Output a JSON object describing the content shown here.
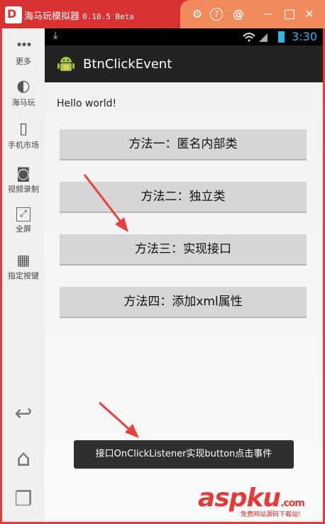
{
  "window": {
    "title": "海马玩模拟器",
    "version": "0.10.5 Beta",
    "logo_letter": "D"
  },
  "titlebar_icons": [
    "gear-icon",
    "help-icon",
    "at-icon",
    "minimize-icon",
    "maximize-icon",
    "close-icon"
  ],
  "titlebar_glyphs": [
    "⚙",
    "?",
    "@",
    "—",
    "□",
    "✕"
  ],
  "sidebar": {
    "items": [
      {
        "icon": "more-icon",
        "glyph": "•••",
        "label": "更多"
      },
      {
        "icon": "haima-icon",
        "glyph": "◐",
        "label": "海马玩"
      },
      {
        "icon": "phone-market-icon",
        "glyph": "▯",
        "label": "手机市场"
      },
      {
        "icon": "video-camera-icon",
        "glyph": "◙",
        "label": "视频录制"
      },
      {
        "icon": "fullscreen-icon",
        "glyph": "⤢",
        "label": "全屏"
      },
      {
        "icon": "keymap-icon",
        "glyph": "▦",
        "label": "指定按键"
      }
    ],
    "nav": [
      {
        "icon": "back-icon",
        "glyph": "↩"
      },
      {
        "icon": "home-icon",
        "glyph": "⌂"
      },
      {
        "icon": "recent-apps-icon",
        "glyph": "❐"
      }
    ]
  },
  "statusbar": {
    "time": "3:30",
    "download_glyph": "⤓"
  },
  "app": {
    "title": "BtnClickEvent",
    "hello_text": "Hello world!",
    "buttons": [
      "方法一：匿名内部类",
      "方法二：独立类",
      "方法三：实现接口",
      "方法四：添加xml属性"
    ],
    "toast": "接口OnClickListener实现button点击事件"
  },
  "watermark": {
    "text": "aspku",
    "suffix": ".com",
    "subtitle": "免费网站源码下载站!"
  },
  "colors": {
    "frame": "#d93232",
    "accent": "#33b5e5",
    "arrow": "#e8403c"
  }
}
